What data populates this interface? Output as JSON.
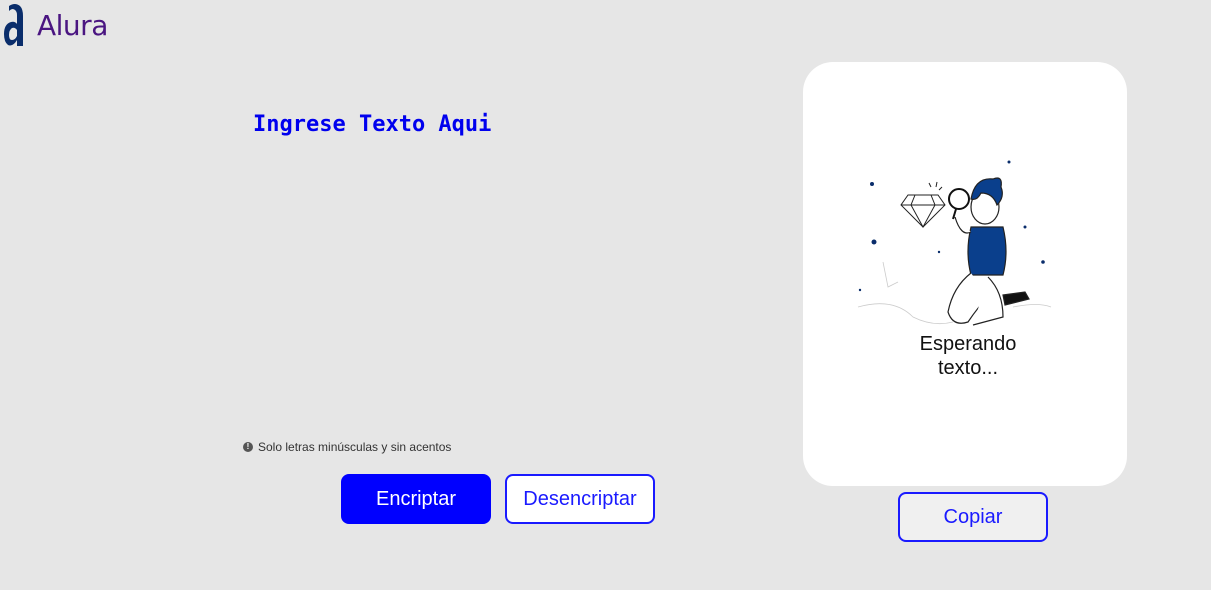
{
  "header": {
    "logo_text": "Alura"
  },
  "input": {
    "placeholder": "Ingrese Texto Aqui",
    "value": ""
  },
  "hint": {
    "icon": "info-icon",
    "text": "Solo letras minúsculas y sin acentos"
  },
  "buttons": {
    "encrypt_label": "Encriptar",
    "decrypt_label": "Desencriptar",
    "copy_label": "Copiar"
  },
  "output": {
    "message_line1": "Esperando",
    "message_line2": "texto..."
  },
  "colors": {
    "accent": "#0000ff",
    "logo": "#4a1581",
    "background": "#e6e6e6",
    "card": "#ffffff"
  }
}
